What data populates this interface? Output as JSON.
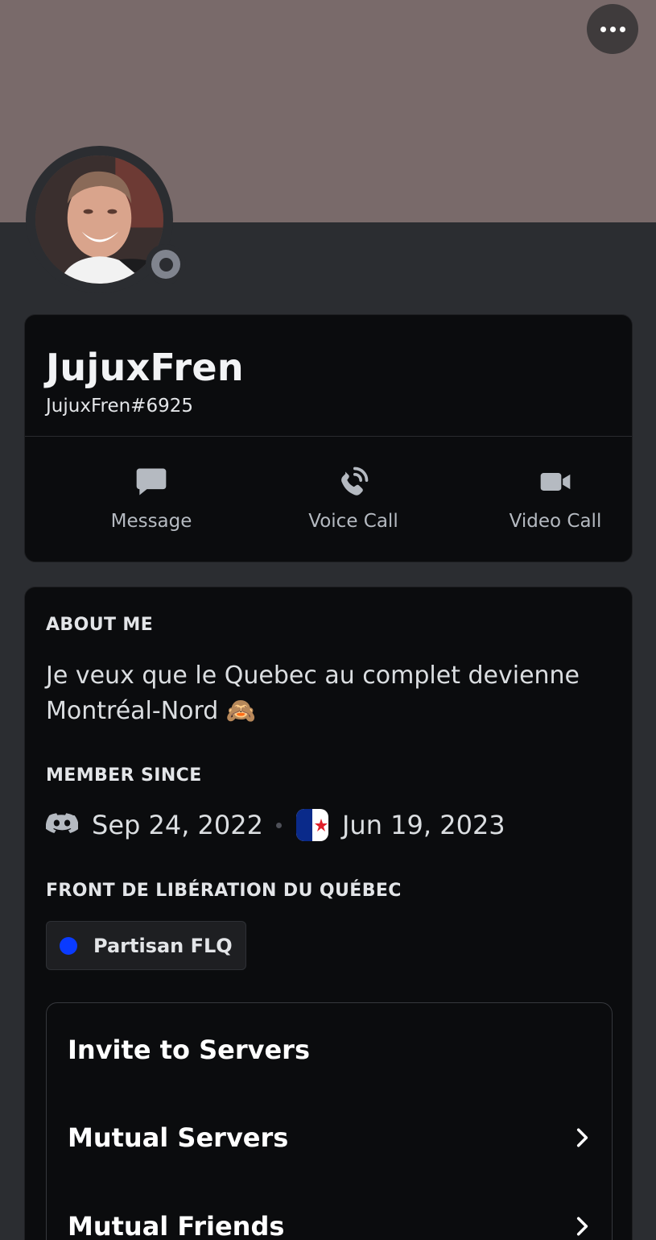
{
  "profile": {
    "display_name": "JujuxFren",
    "username": "JujuxFren#6925",
    "status": "offline"
  },
  "actions": [
    {
      "label": "Message",
      "icon": "message-icon"
    },
    {
      "label": "Voice Call",
      "icon": "voice-call-icon"
    },
    {
      "label": "Video Call",
      "icon": "video-camera-icon"
    }
  ],
  "about": {
    "heading": "ABOUT ME",
    "text": "Je veux que le Quebec au complet  devienne Montréal-Nord 🙈"
  },
  "member_since": {
    "heading": "MEMBER SINCE",
    "discord_date": "Sep 24, 2022",
    "server_date": "Jun 19, 2023"
  },
  "server_roles": {
    "heading": "FRONT DE LIBÉRATION DU QUÉBEC",
    "roles": [
      {
        "name": "Partisan FLQ",
        "color": "#0a3bff"
      }
    ]
  },
  "menu": {
    "items": [
      {
        "label": "Invite to Servers",
        "has_chevron": false
      },
      {
        "label": "Mutual Servers",
        "has_chevron": true
      },
      {
        "label": "Mutual Friends",
        "has_chevron": true
      }
    ]
  },
  "colors": {
    "banner": "#796a6a",
    "background": "#2b2d31",
    "card": "#0b0c0e"
  }
}
